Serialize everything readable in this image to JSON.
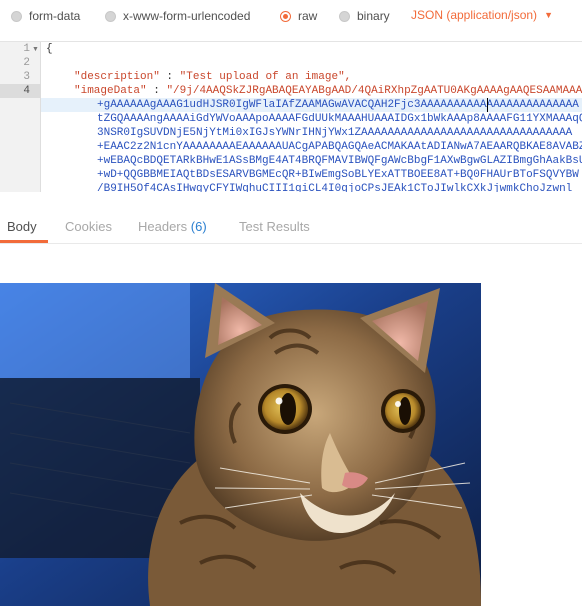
{
  "body_types": {
    "form_data": "form-data",
    "urlencoded": "x-www-form-urlencoded",
    "raw": "raw",
    "binary": "binary",
    "selected": "raw",
    "content_type": "JSON (application/json)"
  },
  "editor": {
    "line_numbers": [
      "1",
      "2",
      "3",
      "4"
    ],
    "line1": "{",
    "line3_key": "\"description\"",
    "line3_sep": " : ",
    "line3_value": "\"Test upload of an image\",",
    "line4_key": "\"imageData\"",
    "line4_sep": " : ",
    "line4_value": "\"/9j/4AAQSkZJRgABAQEAYABgAAD/4QAiRXhpZgAATU0AKgAAAAgAAQESAAMAAAA",
    "wrapped": [
      "+gAAAAAAgAAAG1udHJSR0IgWFlaIAfZAAMAGwAVACQAH2Fjc3AAAAAAAAAAAAAAAAAAAAAAAA",
      "tZGQAAAAngAAAAiGdYWVoAAApoAAAAFGdUUkMAAAHUAAAIDGx1bWkAAAp8AAAAFG11YXMAAAqQ",
      "3NSR0IgSUVDNjE5NjYtMi0xIGJsYWNrIHNjYWx1ZAAAAAAAAAAAAAAAAAAAAAAAAAAAAAAAA",
      "+EAAC2z2N1cnYAAAAAAAAEAAAAAAUACgAPABQAGQAeACMAKAAtADIANwA7AEAARQBKAE8AVABZ",
      "+wEBAQcBDQETARkBHwE1ASsBMgE4AT4BRQFMAVIBWQFgAWcBbgF1AXwBgwGLAZIBmgGhAakBsU",
      "+wD+QQGBBMEIAQtBDsESARVBGMEcQR+BIwEmgSoBLYExATTBOEE8AT+BQ0FHAUrBToFSQVYBW",
      "/B9IH5Of4CAsIHwgyCFYIWghuCIII1giCL4I0gjoCPsJEAk1CToJIwlkCXkJjwmkChoJzwnl"
    ]
  },
  "response_tabs": {
    "body": "Body",
    "cookies": "Cookies",
    "headers": "Headers",
    "headers_count": "(6)",
    "test_results": "Test Results",
    "active": "Body"
  },
  "colors": {
    "accent": "#f26b3a",
    "json_string": "#c9472c",
    "base64_text": "#2a52be",
    "count_blue": "#2a7fd0"
  },
  "icons": [
    "radio-unselected-icon",
    "radio-selected-icon",
    "chevron-down-icon",
    "fold-arrow-icon"
  ]
}
